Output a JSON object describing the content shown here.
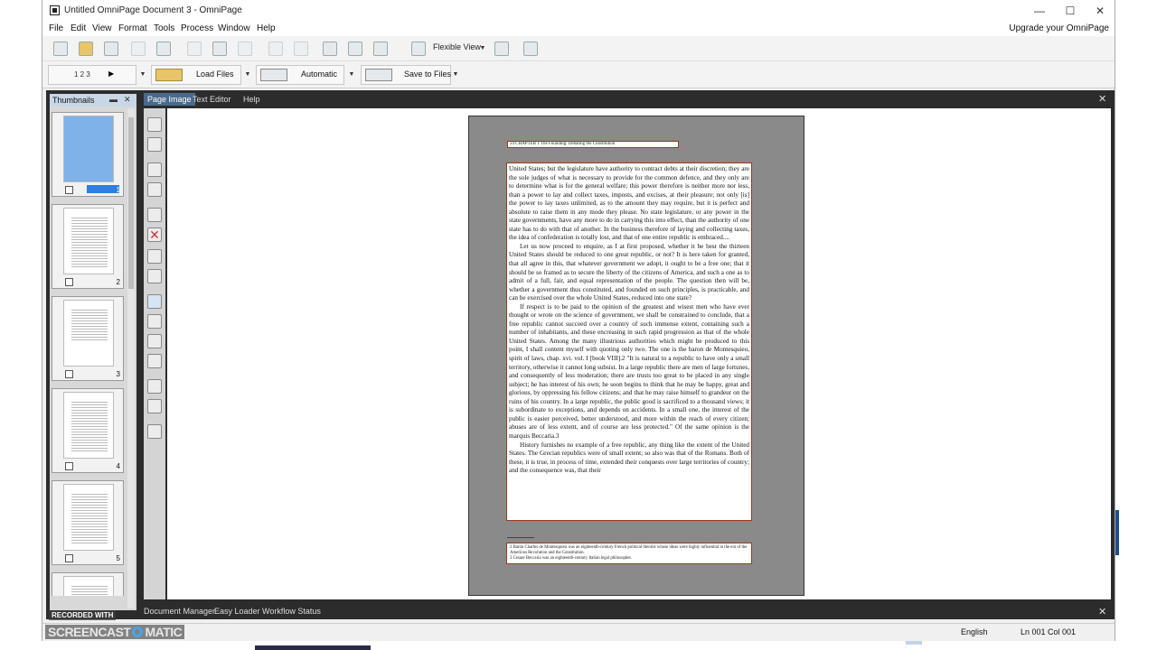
{
  "window": {
    "title": "Untitled OmniPage Document 3 - OmniPage",
    "minimize": "—",
    "maximize": "☐",
    "close": "✕"
  },
  "menu": {
    "items": [
      "File",
      "Edit",
      "View",
      "Format",
      "Tools",
      "Process",
      "Window",
      "Help"
    ],
    "upgrade": "Upgrade your OmniPage"
  },
  "toolbar": {
    "view_mode": "Flexible View"
  },
  "workflow": {
    "steps_label": "1 2 3",
    "load_label": "Load Files",
    "mode_label": "Automatic",
    "save_label": "Save to Files"
  },
  "thumbnails": {
    "title": "Thumbnails",
    "pin": "▬",
    "close": "✕",
    "pages": [
      "1",
      "2",
      "3",
      "4",
      "5"
    ]
  },
  "page_tabs": {
    "tabs": [
      "Page Image",
      "Text Editor",
      "Help"
    ],
    "active": "Page Image",
    "close": "✕"
  },
  "document": {
    "header": "24        CHAPTER 1   The Founding: Debating the Constitution",
    "paragraphs": [
      "United States; but the legislature have authority to contract debts at their discretion; they are the sole judges of what is necessary to provide for the common defence, and they only are to determine what is for the general welfare; this power therefore is neither more nor less, than a power to lay and collect taxes, imposts, and excises, at their pleasure; not only [is] the power to lay taxes unlimited, as to the amount they may require, but it is perfect and absolute to raise them in any mode they please. No state legislature, or any power in the state governments, have any more to do in carrying this into effect, than the authority of one state has to do with that of another. In the business therefore of laying and collecting taxes, the idea of confederation is totally lost, and that of one entire republic is embraced....",
      "Let us now proceed to enquire, as I at first proposed, whether it be best the thirteen United States should be reduced to one great republic, or not? It is here taken for granted, that all agree in this, that whatever government we adopt, it ought to be a free one; that it should be so framed as to secure the liberty of the citizens of America, and such a one as to admit of a full, fair, and equal representation of the people. The question then will be, whether a government thus constituted, and founded on such principles, is practicable, and can be exercised over the whole United States, reduced into one state?",
      "If respect is to be paid to the opinion of the greatest and wisest men who have ever thought or wrote on the science of government, we shall be constrained to conclude, that a free republic cannot succeed over a country of such immense extent, containing such a number of inhabitants, and these encreasing in such rapid progression as that of the whole United States. Among the many illustrious authorities which might be produced to this point, I shall content myself with quoting only two. The one is the baron de Montesquieu, spirit of laws, chap. xvi. vol. I [book VIII].2 \"It is natural to a republic to have only a small territory, otherwise it cannot long subsist. In a large republic there are men of large fortunes, and consequently of less moderation; there are trusts too great to be placed in any single subject; he has interest of his own; he soon begins to think that he may be happy, great and glorious, by oppressing his fellow citizens; and that he may raise himself to grandeur on the ruins of his country. In a large republic, the public good is sacrificed to a thousand views; it is subordinate to exceptions, and depends on accidents. In a small one, the interest of the public is easier perceived, better understood, and more within the reach of every citizen; abuses are of less extent, and of course are less protected.\" Of the same opinion is the marquis Beccaria.3",
      "History furnishes no example of a free republic, any thing like the extent of the United States. The Grecian republics were of small extent; so also was that of the Romans. Both of these, it is true, in process of time, extended their conquests over large territories of country; and the consequence was, that their"
    ],
    "footnotes": [
      "2 Baron Charles de Montesquieu was an eighteenth-century French political theorist whose ideas were highly influential in the era of the American Revolution and the Constitution.",
      "3 Cesare Beccaria was an eighteenth-century Italian legal philosopher."
    ]
  },
  "bottom_tabs": [
    "Document Manager",
    "Easy Loader",
    "Workflow Status"
  ],
  "status": {
    "language": "English",
    "position": "Ln 001  Col 001"
  },
  "watermark": {
    "top": "RECORDED WITH",
    "left": "SCREENCAST",
    "right": "MATIC"
  },
  "colors": {
    "selection_blue": "#2f7fdf",
    "zone_border": "#9a3a1a",
    "dark_panel": "#2c2c2c"
  }
}
